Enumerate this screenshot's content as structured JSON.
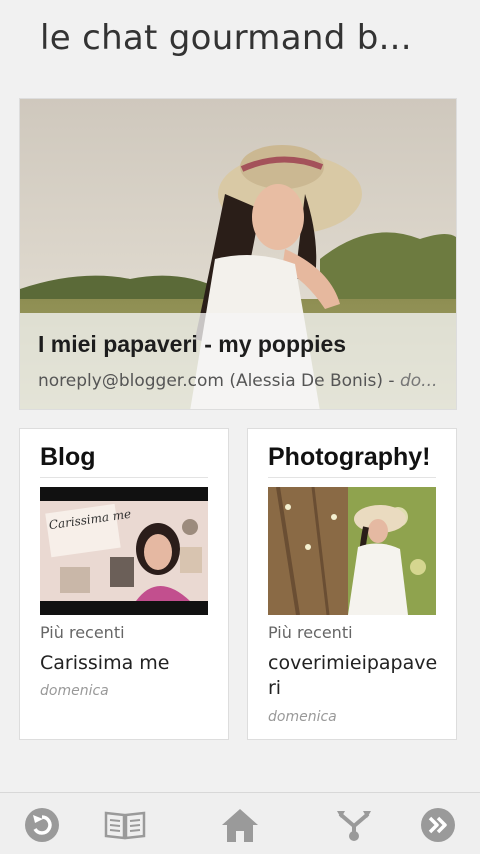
{
  "header": {
    "title": "le chat gourmand b..."
  },
  "featured": {
    "title": "I miei papaveri - my poppies",
    "author": "noreply@blogger.com (Alessia De Bonis) -",
    "date_truncated": "do..."
  },
  "cards": [
    {
      "title": "Blog",
      "label": "Più recenti",
      "item_title": "Carissima me",
      "date": "domenica",
      "thumb_text": "Carissima me"
    },
    {
      "title": "Photography!",
      "label": "Più recenti",
      "item_title": "coverimieipapaveri",
      "date": "domenica"
    }
  ],
  "toolbar": {
    "icons": [
      "back-icon",
      "book-icon",
      "home-icon",
      "share-icon",
      "forward-icon"
    ],
    "icon_color": "#9a9a9a"
  }
}
